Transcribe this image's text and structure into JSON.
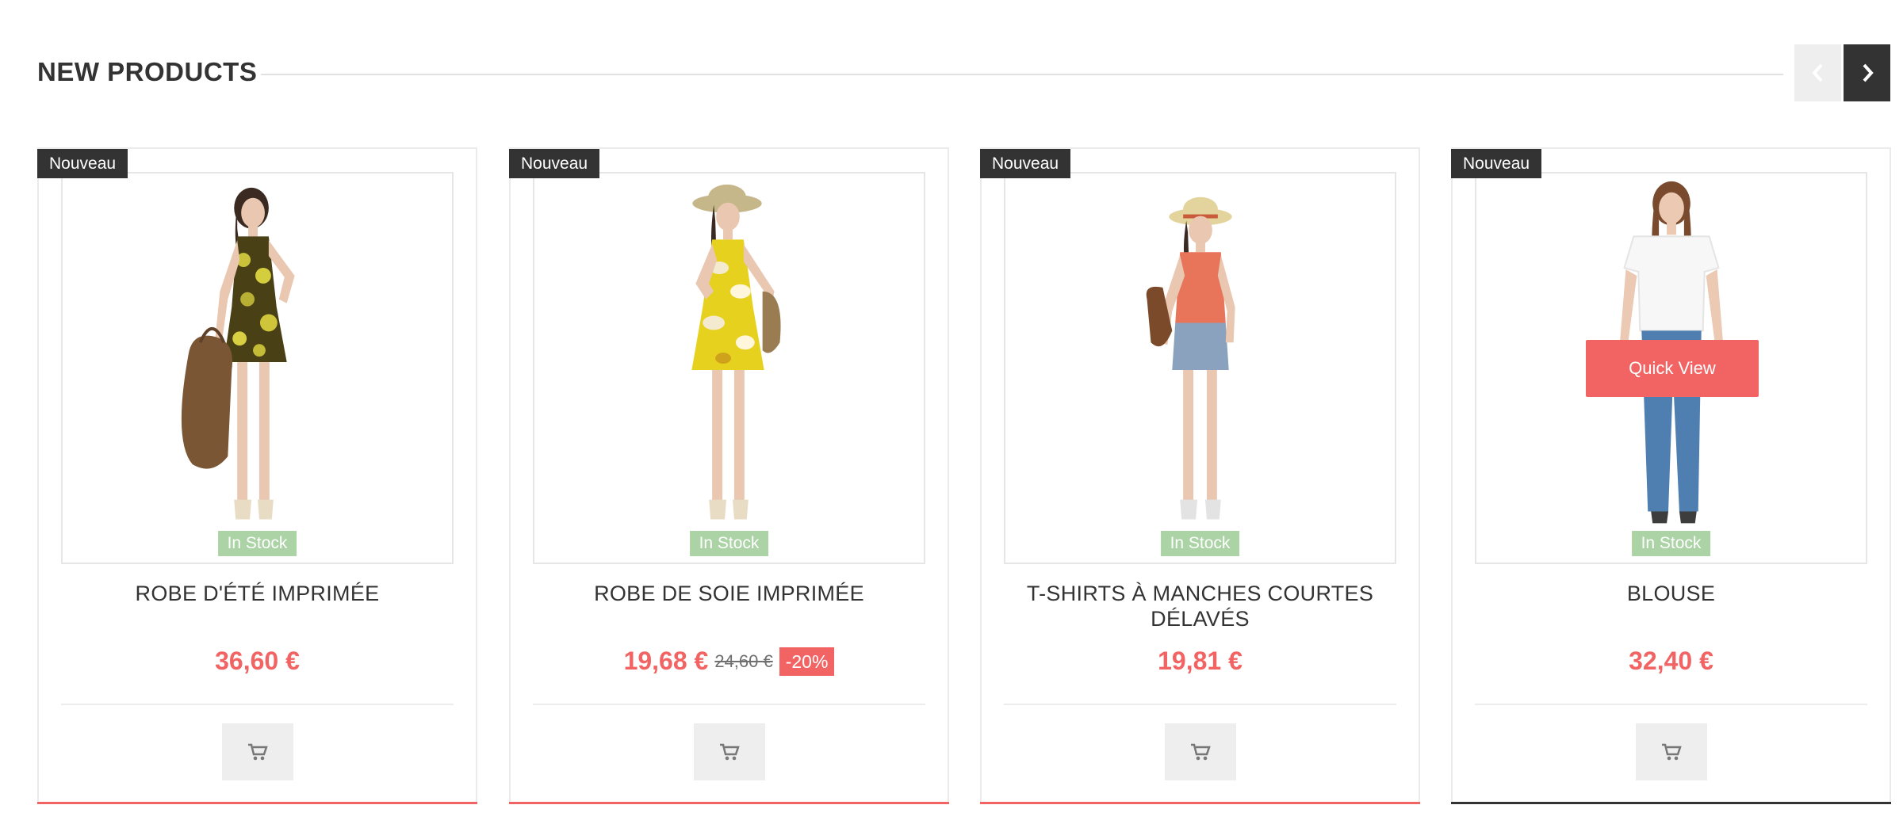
{
  "section": {
    "title": "NEW PRODUCTS",
    "prev_icon": "chevron-left-icon",
    "next_icon": "chevron-right-icon"
  },
  "products": [
    {
      "badge": "Nouveau",
      "stock": "In Stock",
      "name": "ROBE D'ÉTÉ IMPRIMÉE",
      "price": "36,60 €",
      "old_price": "",
      "discount": ""
    },
    {
      "badge": "Nouveau",
      "stock": "In Stock",
      "name": "ROBE DE SOIE IMPRIMÉE",
      "price": "19,68 €",
      "old_price": "24,60 €",
      "discount": "-20%"
    },
    {
      "badge": "Nouveau",
      "stock": "In Stock",
      "name": "T-SHIRTS À MANCHES COURTES DÉLAVÉS",
      "price": "19,81 €",
      "old_price": "",
      "discount": ""
    },
    {
      "badge": "Nouveau",
      "stock": "In Stock",
      "name": "BLOUSE",
      "price": "32,40 €",
      "old_price": "",
      "discount": "",
      "quick_view": "Quick View"
    }
  ],
  "colors": {
    "accent": "#f26464",
    "dark": "#333333",
    "stock": "#abd3a5"
  }
}
